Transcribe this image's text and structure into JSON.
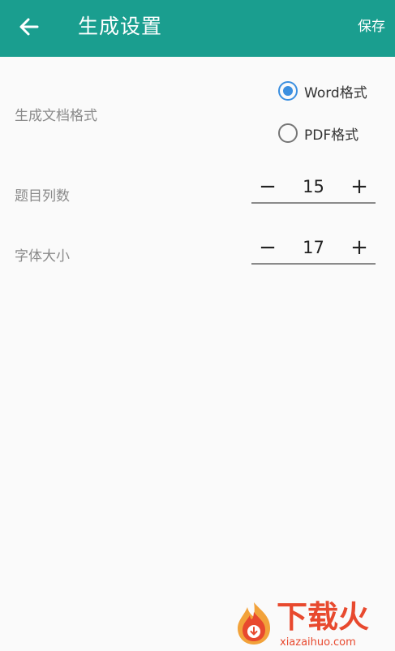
{
  "header": {
    "back_icon": "arrow-left-icon",
    "title": "生成设置",
    "save_label": "保存",
    "background": "#1a9e8f"
  },
  "settings": {
    "format": {
      "label": "生成文档格式",
      "options": [
        {
          "label": "Word格式",
          "selected": true
        },
        {
          "label": "PDF格式",
          "selected": false
        }
      ]
    },
    "columns": {
      "label": "题目列数",
      "minus": "−",
      "value": "15",
      "plus": "+"
    },
    "font_size": {
      "label": "字体大小",
      "minus": "−",
      "value": "17",
      "plus": "+"
    }
  },
  "watermark": {
    "logo_icon": "flame-logo-icon",
    "text": "下载火",
    "domain": "xiazaihuo.com"
  },
  "colors": {
    "accent": "#3b8fe0",
    "brand_watermark": "#e8492e"
  }
}
